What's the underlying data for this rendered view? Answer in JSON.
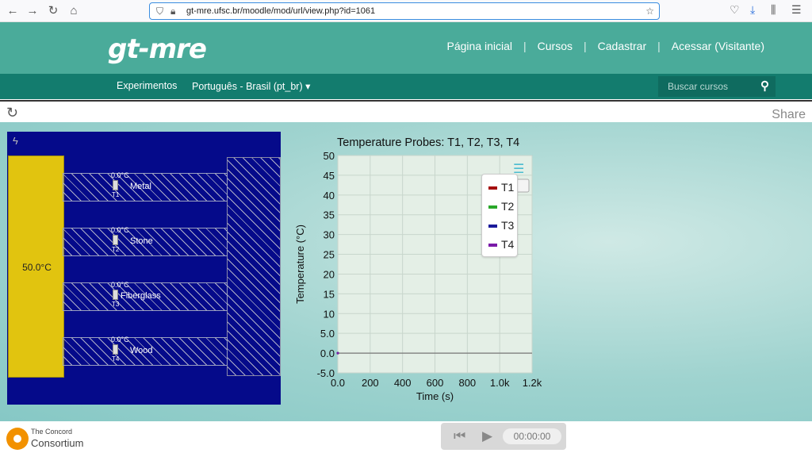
{
  "browser": {
    "url": "gt-mre.ufsc.br/moodle/mod/url/view.php?id=1061"
  },
  "site": {
    "logo": "gt-mre",
    "nav": [
      "Página inicial",
      "Cursos",
      "Cadastrar",
      "Acessar (Visitante)"
    ],
    "bar_items": [
      "Experimentos",
      "Português - Brasil (pt_br) ▾"
    ],
    "search_placeholder": "Buscar cursos"
  },
  "strip": {
    "share": "Share"
  },
  "simulation": {
    "source_temp": "50.0°C",
    "bars": [
      {
        "name": "Metal",
        "probe_temp": "0.0°C",
        "probe_id": "T1"
      },
      {
        "name": "Stone",
        "probe_temp": "0.0°C",
        "probe_id": "T2"
      },
      {
        "name": "Fiberglass",
        "probe_temp": "0.0°C",
        "probe_id": "T3"
      },
      {
        "name": "Wood",
        "probe_temp": "0.0°C",
        "probe_id": "T4"
      }
    ]
  },
  "chart_data": {
    "type": "line",
    "title": "Temperature Probes: T1, T2, T3, T4",
    "xlabel": "Time (s)",
    "ylabel": "Temperature (°C)",
    "xlim": [
      0,
      1200
    ],
    "ylim": [
      -5,
      50
    ],
    "x_ticks": [
      "0.0",
      "200",
      "400",
      "600",
      "800",
      "1.0k",
      "1.2k"
    ],
    "y_ticks": [
      "50",
      "45",
      "40",
      "35",
      "30",
      "25",
      "20",
      "15",
      "10",
      "5.0",
      "0.0",
      "-5.0"
    ],
    "grid": true,
    "legend_position": "top-right",
    "series": [
      {
        "name": "T1",
        "color": "#a50f0f",
        "x": [
          0
        ],
        "y": [
          0
        ]
      },
      {
        "name": "T2",
        "color": "#2aa82a",
        "x": [
          0
        ],
        "y": [
          0
        ]
      },
      {
        "name": "T3",
        "color": "#1a1a9a",
        "x": [
          0
        ],
        "y": [
          0
        ]
      },
      {
        "name": "T4",
        "color": "#7a1aa8",
        "x": [
          0
        ],
        "y": [
          0
        ]
      }
    ]
  },
  "footer": {
    "brand_small": "The Concord",
    "brand_large": "Consortium",
    "time": "00:00:00"
  }
}
